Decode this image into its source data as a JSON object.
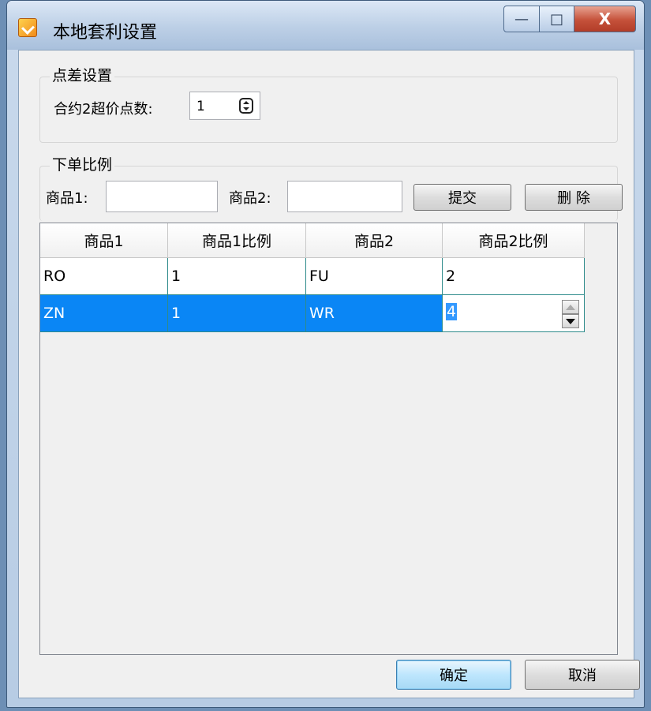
{
  "window": {
    "title": "本地套利设置",
    "icon": "app-icon"
  },
  "title_buttons": {
    "min": "—",
    "max": "□",
    "close": "X"
  },
  "spread_group": {
    "legend": "点差设置",
    "label": "合约2超价点数:",
    "value": "1"
  },
  "ratio_group": {
    "legend": "下单比例",
    "item1_label": "商品1:",
    "item1_value": "",
    "item2_label": "商品2:",
    "item2_value": "",
    "submit_label": "提交",
    "delete_label": "删 除"
  },
  "table": {
    "columns": [
      "商品1",
      "商品1比例",
      "商品2",
      "商品2比例"
    ],
    "rows": [
      {
        "item1": "RO",
        "ratio1": "1",
        "item2": "FU",
        "ratio2": "2"
      },
      {
        "item1": "ZN",
        "ratio1": "1",
        "item2": "WR",
        "ratio2": "4"
      }
    ],
    "selected_row": 1
  },
  "footer": {
    "ok_label": "确定",
    "cancel_label": "取消"
  },
  "colors": {
    "selection": "#0a86f5",
    "row_border": "#2e8b8b"
  }
}
